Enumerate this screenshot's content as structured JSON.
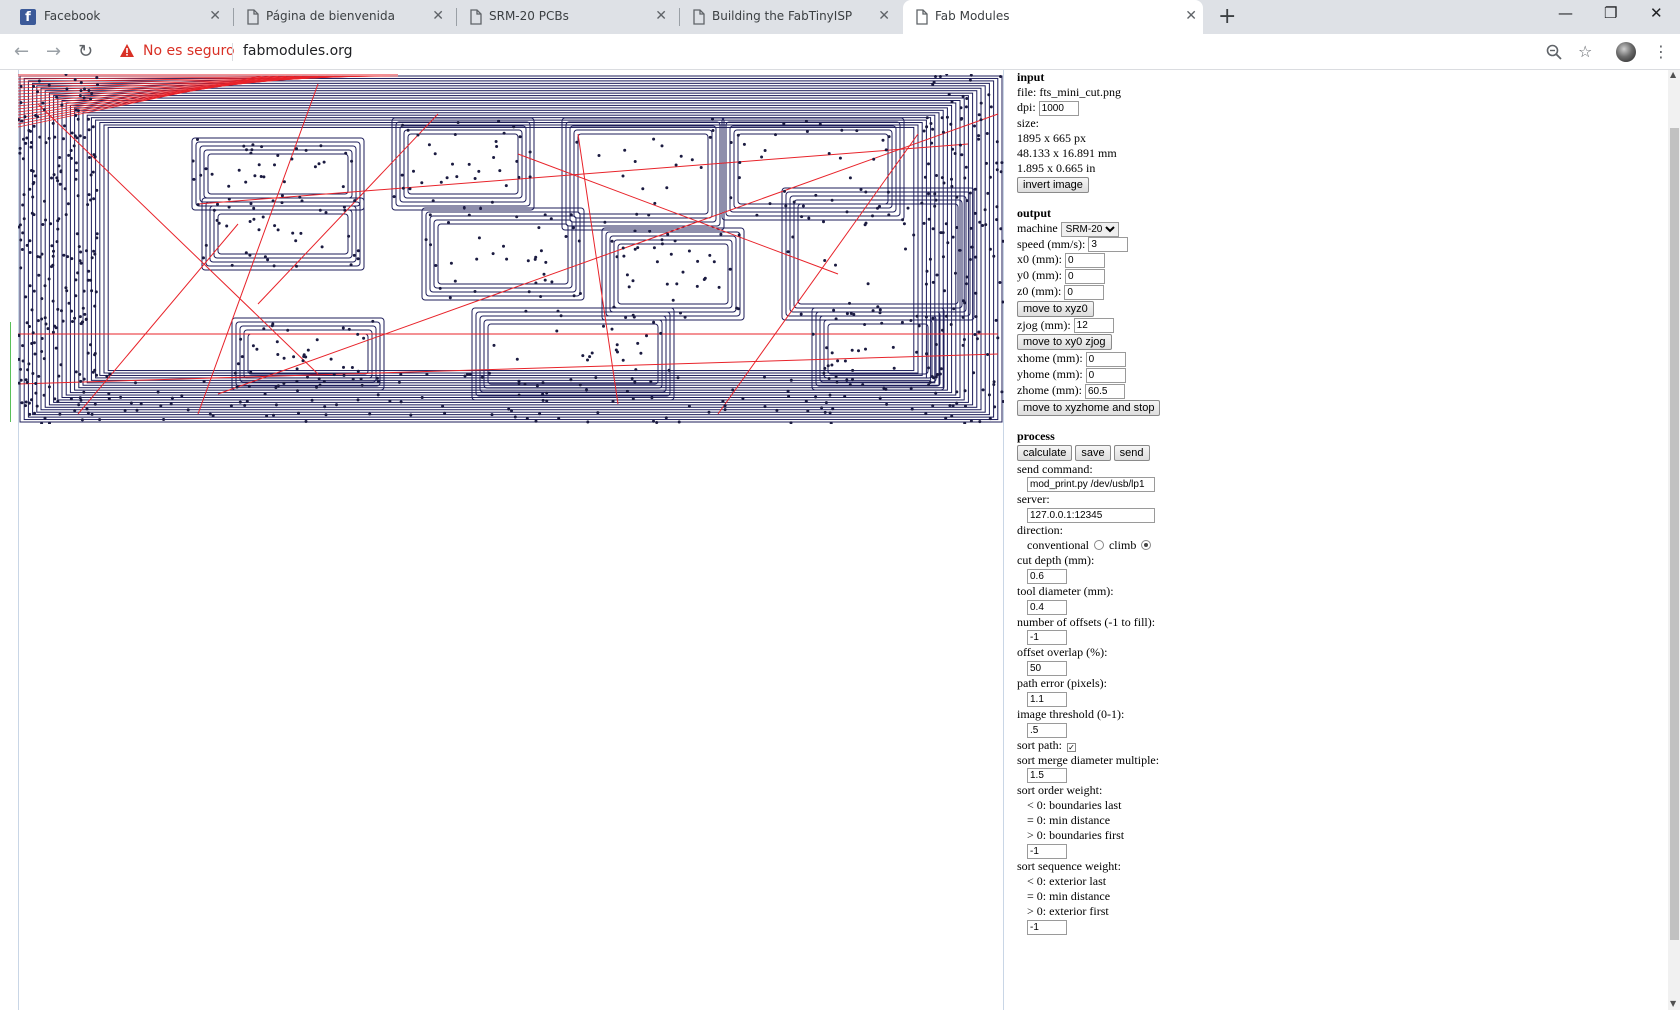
{
  "browser": {
    "tabs": [
      {
        "title": "Facebook",
        "icon": "facebook-icon"
      },
      {
        "title": "Página de bienvenida",
        "icon": "page-icon"
      },
      {
        "title": "SRM-20 PCBs",
        "icon": "page-icon"
      },
      {
        "title": "Building the FabTinyISP",
        "icon": "page-icon"
      },
      {
        "title": "Fab Modules",
        "icon": "page-icon",
        "active": true
      }
    ],
    "close_glyph": "✕",
    "new_tab_glyph": "+",
    "security_label": "No es seguro",
    "url": "fabmodules.org"
  },
  "input": {
    "title": "input",
    "file_label": "file: fts_mini_cut.png",
    "dpi_label": "dpi:",
    "dpi": "1000",
    "size_label": "size:",
    "size_px": "1895 x 665 px",
    "size_mm": "48.133 x 16.891 mm",
    "size_in": "1.895 x 0.665 in",
    "invert_button": "invert image"
  },
  "output": {
    "title": "output",
    "machine_label": "machine",
    "machine": "SRM-20",
    "speed_label": "speed (mm/s):",
    "speed": "3",
    "x0_label": "x0 (mm):",
    "x0": "0",
    "y0_label": "y0 (mm):",
    "y0": "0",
    "z0_label": "z0 (mm):",
    "z0": "0",
    "move_xyz0_button": "move to xyz0",
    "zjog_label": "zjog (mm):",
    "zjog": "12",
    "move_xy0_zjog_button": "move to xy0 zjog",
    "xhome_label": "xhome (mm):",
    "xhome": "0",
    "yhome_label": "yhome (mm):",
    "yhome": "0",
    "zhome_label": "zhome (mm):",
    "zhome": "60.5",
    "move_home_button": "move to xyzhome and stop"
  },
  "process": {
    "title": "process",
    "calculate_button": "calculate",
    "save_button": "save",
    "send_button": "send",
    "send_command_label": "send command:",
    "send_command": "mod_print.py /dev/usb/lp1",
    "server_label": "server:",
    "server": "127.0.0.1:12345",
    "direction_label": "direction:",
    "conventional_label": "conventional",
    "climb_label": "climb",
    "direction_selected": "climb",
    "cut_depth_label": "cut depth (mm):",
    "cut_depth": "0.6",
    "tool_diameter_label": "tool diameter (mm):",
    "tool_diameter": "0.4",
    "offsets_label": "number of offsets (-1 to fill):",
    "offsets": "-1",
    "overlap_label": "offset overlap (%):",
    "overlap": "50",
    "path_error_label": "path error (pixels):",
    "path_error": "1.1",
    "threshold_label": "image threshold (0-1):",
    "threshold": ".5",
    "sort_path_label": "sort path:",
    "sort_path_checked": true,
    "merge_label": "sort merge diameter multiple:",
    "merge": "1.5",
    "order_weight_label": "sort order weight:",
    "order_lt": "< 0: boundaries last",
    "order_eq": "= 0: min distance",
    "order_gt": "> 0: boundaries first",
    "order_weight": "-1",
    "sequence_weight_label": "sort sequence weight:",
    "seq_lt": "< 0: exterior last",
    "seq_eq": "= 0: min distance",
    "seq_gt": "> 0: exterior first",
    "sequence_weight": "-1"
  },
  "colors": {
    "toolpath": "#1c1c5a",
    "move_path": "#e8232a",
    "node": "#1a1a40"
  }
}
